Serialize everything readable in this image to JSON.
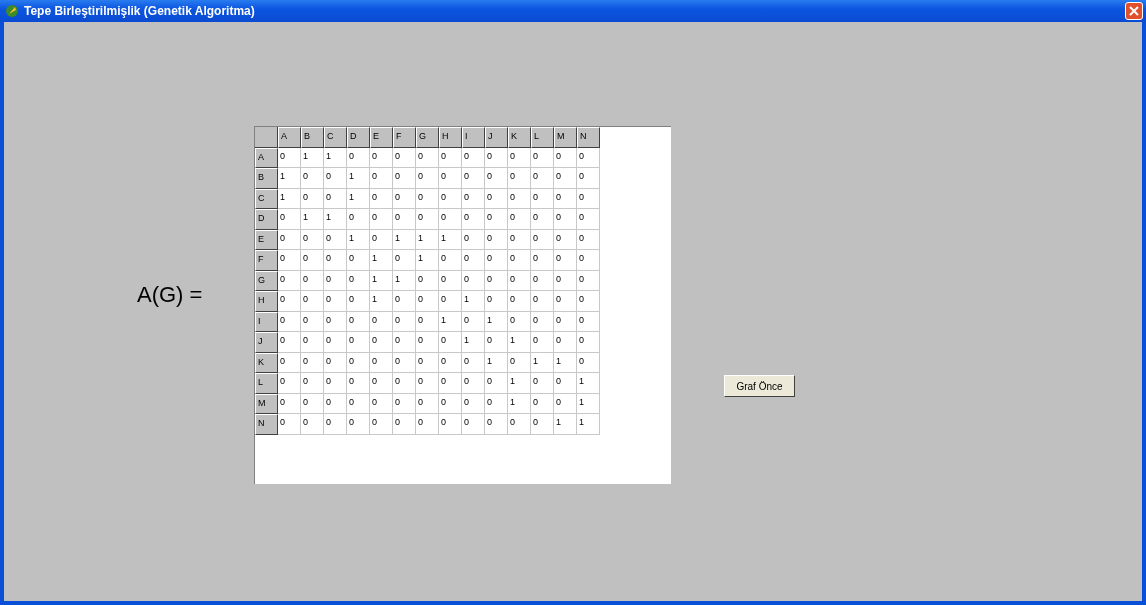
{
  "window": {
    "title": "Tepe Birleştirilmişlik (Genetik Algoritma)"
  },
  "formula_label": "A(G) =",
  "matrix": {
    "columns": [
      "A",
      "B",
      "C",
      "D",
      "E",
      "F",
      "G",
      "H",
      "I",
      "J",
      "K",
      "L",
      "M",
      "N"
    ],
    "rows": [
      {
        "label": "A",
        "cells": [
          "0",
          "1",
          "1",
          "0",
          "0",
          "0",
          "0",
          "0",
          "0",
          "0",
          "0",
          "0",
          "0",
          "0"
        ]
      },
      {
        "label": "B",
        "cells": [
          "1",
          "0",
          "0",
          "1",
          "0",
          "0",
          "0",
          "0",
          "0",
          "0",
          "0",
          "0",
          "0",
          "0"
        ]
      },
      {
        "label": "C",
        "cells": [
          "1",
          "0",
          "0",
          "1",
          "0",
          "0",
          "0",
          "0",
          "0",
          "0",
          "0",
          "0",
          "0",
          "0"
        ]
      },
      {
        "label": "D",
        "cells": [
          "0",
          "1",
          "1",
          "0",
          "0",
          "0",
          "0",
          "0",
          "0",
          "0",
          "0",
          "0",
          "0",
          "0"
        ]
      },
      {
        "label": "E",
        "cells": [
          "0",
          "0",
          "0",
          "1",
          "0",
          "1",
          "1",
          "1",
          "0",
          "0",
          "0",
          "0",
          "0",
          "0"
        ]
      },
      {
        "label": "F",
        "cells": [
          "0",
          "0",
          "0",
          "0",
          "1",
          "0",
          "1",
          "0",
          "0",
          "0",
          "0",
          "0",
          "0",
          "0"
        ]
      },
      {
        "label": "G",
        "cells": [
          "0",
          "0",
          "0",
          "0",
          "1",
          "1",
          "0",
          "0",
          "0",
          "0",
          "0",
          "0",
          "0",
          "0"
        ]
      },
      {
        "label": "H",
        "cells": [
          "0",
          "0",
          "0",
          "0",
          "1",
          "0",
          "0",
          "0",
          "1",
          "0",
          "0",
          "0",
          "0",
          "0"
        ]
      },
      {
        "label": "I",
        "cells": [
          "0",
          "0",
          "0",
          "0",
          "0",
          "0",
          "0",
          "1",
          "0",
          "1",
          "0",
          "0",
          "0",
          "0"
        ]
      },
      {
        "label": "J",
        "cells": [
          "0",
          "0",
          "0",
          "0",
          "0",
          "0",
          "0",
          "0",
          "1",
          "0",
          "1",
          "0",
          "0",
          "0"
        ]
      },
      {
        "label": "K",
        "cells": [
          "0",
          "0",
          "0",
          "0",
          "0",
          "0",
          "0",
          "0",
          "0",
          "1",
          "0",
          "1",
          "1",
          "0"
        ]
      },
      {
        "label": "L",
        "cells": [
          "0",
          "0",
          "0",
          "0",
          "0",
          "0",
          "0",
          "0",
          "0",
          "0",
          "1",
          "0",
          "0",
          "1"
        ]
      },
      {
        "label": "M",
        "cells": [
          "0",
          "0",
          "0",
          "0",
          "0",
          "0",
          "0",
          "0",
          "0",
          "0",
          "1",
          "0",
          "0",
          "1"
        ]
      },
      {
        "label": "N",
        "cells": [
          "0",
          "0",
          "0",
          "0",
          "0",
          "0",
          "0",
          "0",
          "0",
          "0",
          "0",
          "0",
          "1",
          "1"
        ]
      }
    ]
  },
  "buttons": [
    "Graf Önce"
  ]
}
